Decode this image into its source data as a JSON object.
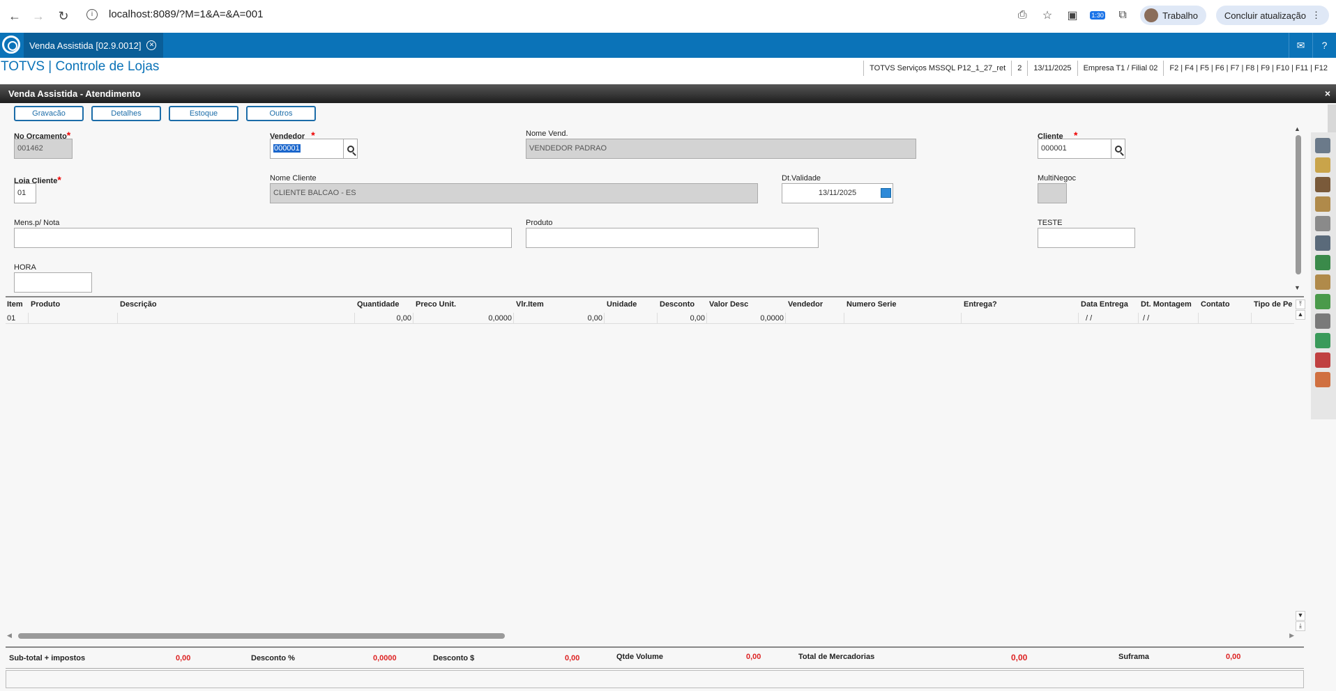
{
  "browser": {
    "url": "localhost:8089/?M=1&A=&A=001",
    "profile_label": "Trabalho",
    "update_label": "Concluir atualização",
    "badge": "1:30"
  },
  "app": {
    "tab_label": "Venda Assistida [02.9.0012]",
    "title": "TOTVS | Controle de Lojas",
    "info": [
      "TOTVS Serviços MSSQL P12_1_27_ret",
      "2",
      "13/11/2025",
      "Empresa T1 / Filial 02",
      "F2 | F4 | F5 | F6 | F7 | F8 | F9 | F10 | F11 | F12"
    ]
  },
  "dialog": {
    "title": "Venda Assistida - Atendimento",
    "close": "×"
  },
  "toolbar": {
    "gravacao": "Gravacão",
    "detalhes": "Detalhes",
    "estoque": "Estoque",
    "outros": "Outros"
  },
  "form": {
    "no_orcamento_label": "No Orcamento",
    "no_orcamento": "001462",
    "vendedor_label": "Vendedor",
    "vendedor": "000001",
    "nome_vend_label": "Nome Vend.",
    "nome_vend": "VENDEDOR PADRAO",
    "cliente_label": "Cliente",
    "cliente": "000001",
    "loja_cliente_label": "Loja Cliente",
    "loja_cliente": "01",
    "nome_cliente_label": "Nome Cliente",
    "nome_cliente": "CLIENTE BALCAO - ES",
    "dt_validade_label": "Dt.Validade",
    "dt_validade": "13/11/2025",
    "multinegoc_label": "MultiNegoc",
    "mens_nota_label": "Mens.p/ Nota",
    "produto_label": "Produto",
    "teste_label": "TESTE",
    "hora_label": "HORA",
    "required_mark": "*"
  },
  "grid": {
    "columns": [
      "Item",
      "Produto",
      "Descrição",
      "Quantidade",
      "Preco Unit.",
      "Vlr.Item",
      "Unidade",
      "Desconto",
      "Valor Desc",
      "Vendedor",
      "Numero Serie",
      "Entrega?",
      "Data Entrega",
      "Dt. Montagem",
      "Contato",
      "Tipo de Pe"
    ],
    "row": [
      "01",
      "",
      "",
      "0,00",
      "0,0000",
      "0,00",
      "",
      "0,00",
      "0,0000",
      "",
      "",
      "",
      "/ /",
      "/ /",
      "",
      ""
    ]
  },
  "totals": {
    "subtotal_label": "Sub-total + impostos",
    "subtotal": "0,00",
    "desconto_pct_label": "Desconto %",
    "desconto_pct": "0,0000",
    "desconto_val_label": "Desconto $",
    "desconto_val": "0,00",
    "qtde_volume_label": "Qtde Volume",
    "qtde_volume": "0,00",
    "total_merc_label": "Total de Mercadorias",
    "total_merc": "0,00",
    "suframa_label": "Suframa",
    "suframa": "0,00"
  },
  "colors": {
    "brand_blue": "#0b73b8",
    "required_red": "#e00000",
    "value_red": "#d22222"
  }
}
